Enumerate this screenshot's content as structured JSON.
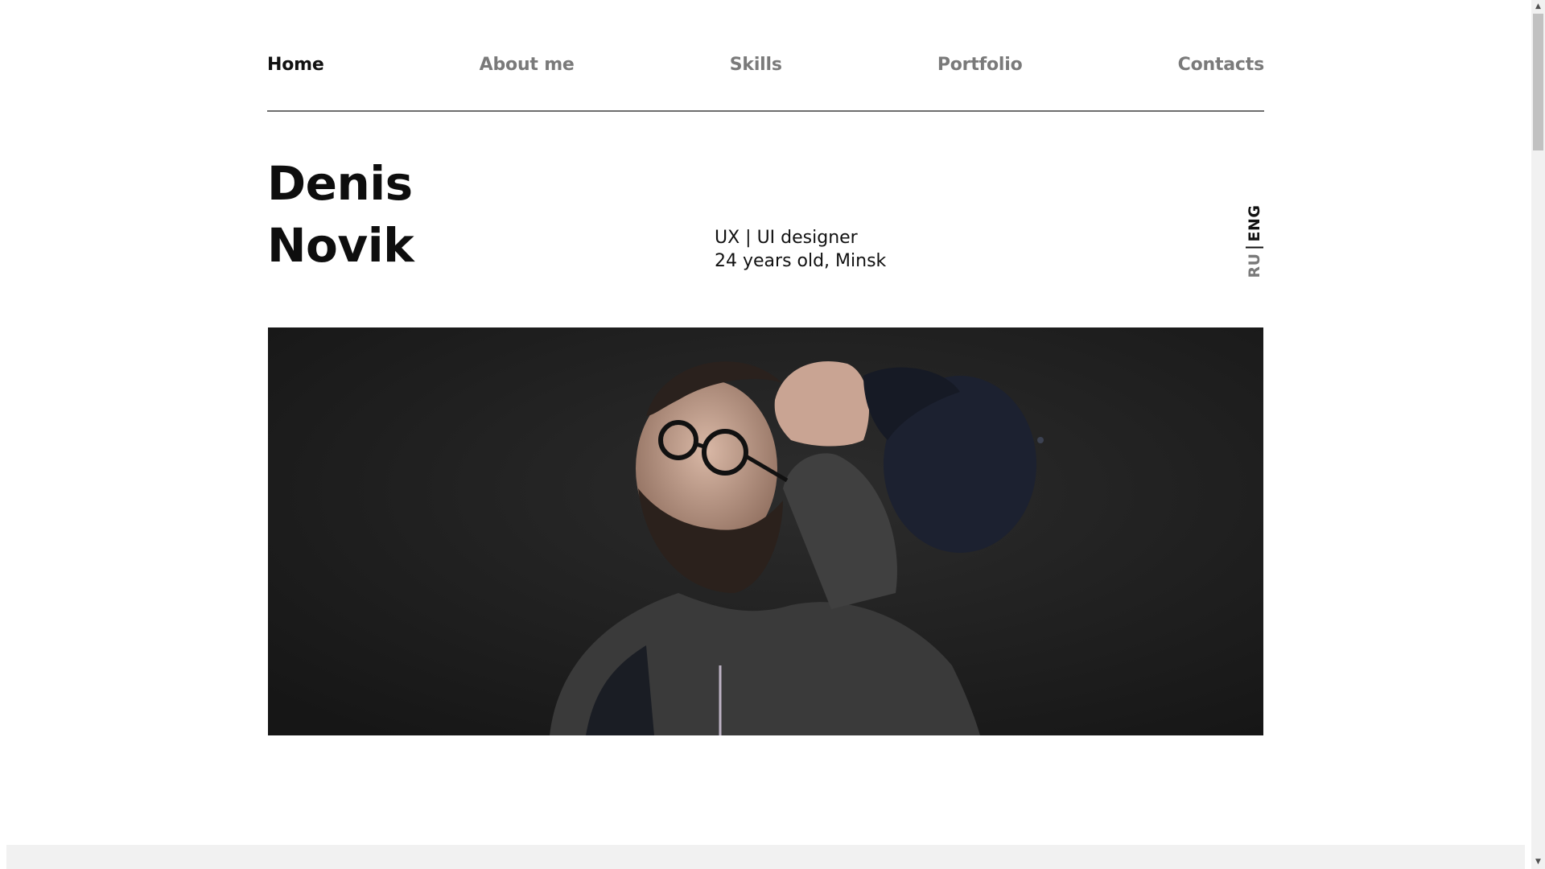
{
  "nav": {
    "items": [
      {
        "label": "Home",
        "active": true
      },
      {
        "label": "About me",
        "active": false
      },
      {
        "label": "Skills",
        "active": false
      },
      {
        "label": "Portfolio",
        "active": false
      },
      {
        "label": "Contacts",
        "active": false
      }
    ]
  },
  "hero": {
    "first_name": "Denis",
    "last_name": "Novik",
    "role": "UX | UI designer",
    "details": "24 years old, Minsk"
  },
  "language": {
    "options": [
      "RU",
      "ENG"
    ],
    "active": "ENG"
  },
  "photo": {
    "subject": "portrait-photo"
  },
  "colors": {
    "text": "#111111",
    "muted": "#7a7a7a",
    "divider": "#6e6e6e",
    "photo_bg": "#1f1f1f"
  }
}
